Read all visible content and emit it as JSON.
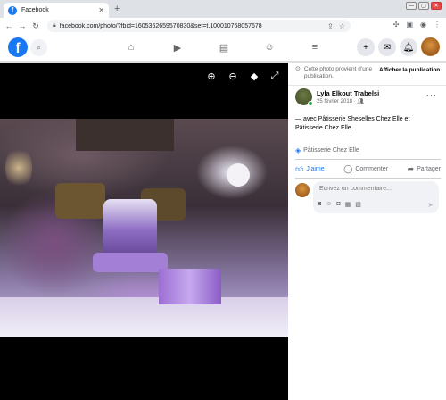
{
  "browser": {
    "tab_title": "Facebook",
    "tab_close": "✕",
    "new_tab": "+",
    "url": "facebook.com/photo/?fbid=1605362659570830&set=t.100010768057678",
    "window_controls": [
      "—",
      "▢",
      "✕"
    ]
  },
  "fb_nav": {
    "logo": "f",
    "icons": [
      "search-icon",
      "home-icon",
      "watch-icon",
      "marketplace-icon",
      "groups-icon",
      "menu-icon",
      "create-icon",
      "messenger-icon",
      "notifications-icon",
      "account-avatar"
    ]
  },
  "viewer": {
    "tools": [
      "zoom-in-icon",
      "zoom-out-icon",
      "tag-icon",
      "fullscreen-icon"
    ]
  },
  "panel": {
    "source_text": "Cette photo provient d’une publication.",
    "show_publication": "Afficher la publication",
    "author_name": "Lyla Elkout Trabelsi",
    "date": "25 février 2018 · ",
    "more": "···",
    "caption_line1": "— avec Pâtisserie Sheselles Chez Elle et",
    "caption_line2": "Pâtisserie Chez Elle.",
    "tag": "Pâtisserie Chez Elle",
    "like": "J’aime",
    "comment": "Commenter",
    "share": "Partager",
    "comment_placeholder": "Écrivez un commentaire..."
  },
  "colors": {
    "facebook_blue": "#1877f2",
    "online_green": "#31a24c"
  }
}
